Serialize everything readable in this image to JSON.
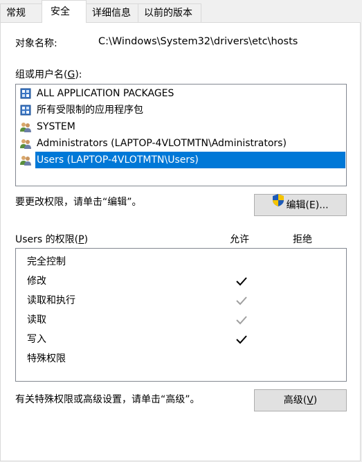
{
  "tabs": [
    "常规",
    "安全",
    "详细信息",
    "以前的版本"
  ],
  "active_tab": "安全",
  "object_name": {
    "label": "对象名称:",
    "value": "C:\\Windows\\System32\\drivers\\etc\\hosts"
  },
  "groups": {
    "label_prefix": "组或用户名(",
    "label_key": "G",
    "label_suffix": "):",
    "items": [
      {
        "name": "ALL APPLICATION PACKAGES",
        "icon": "app-package-icon",
        "selected": false
      },
      {
        "name": "所有受限制的应用程序包",
        "icon": "app-package-icon",
        "selected": false
      },
      {
        "name": "SYSTEM",
        "icon": "user-group-icon",
        "selected": false
      },
      {
        "name": "Administrators (LAPTOP-4VLOTMTN\\Administrators)",
        "icon": "user-group-icon",
        "selected": false
      },
      {
        "name": "Users (LAPTOP-4VLOTMTN\\Users)",
        "icon": "user-group-icon",
        "selected": true
      }
    ]
  },
  "edit": {
    "hint": "要更改权限，请单击“编辑”。",
    "button_label": "编辑(E)..."
  },
  "permissions": {
    "header_prefix": "Users 的权限(",
    "header_key": "P",
    "header_suffix": ")",
    "allow_header": "允许",
    "deny_header": "拒绝",
    "rows": [
      {
        "name": "完全控制",
        "allow": "none",
        "deny": "none"
      },
      {
        "name": "修改",
        "allow": "checked",
        "deny": "none"
      },
      {
        "name": "读取和执行",
        "allow": "inherited",
        "deny": "none"
      },
      {
        "name": "读取",
        "allow": "inherited",
        "deny": "none"
      },
      {
        "name": "写入",
        "allow": "checked",
        "deny": "none"
      },
      {
        "name": "特殊权限",
        "allow": "none",
        "deny": "none"
      }
    ]
  },
  "advanced": {
    "hint": "有关特殊权限或高级设置，请单击“高级”。",
    "button_prefix": "高级(",
    "button_key": "V",
    "button_suffix": ")"
  },
  "colors": {
    "selection": "#0078d7",
    "check": "#000000",
    "check_inherited": "#a0a0a0",
    "shield_blue": "#1e5bb8",
    "shield_yellow": "#f5c400"
  }
}
